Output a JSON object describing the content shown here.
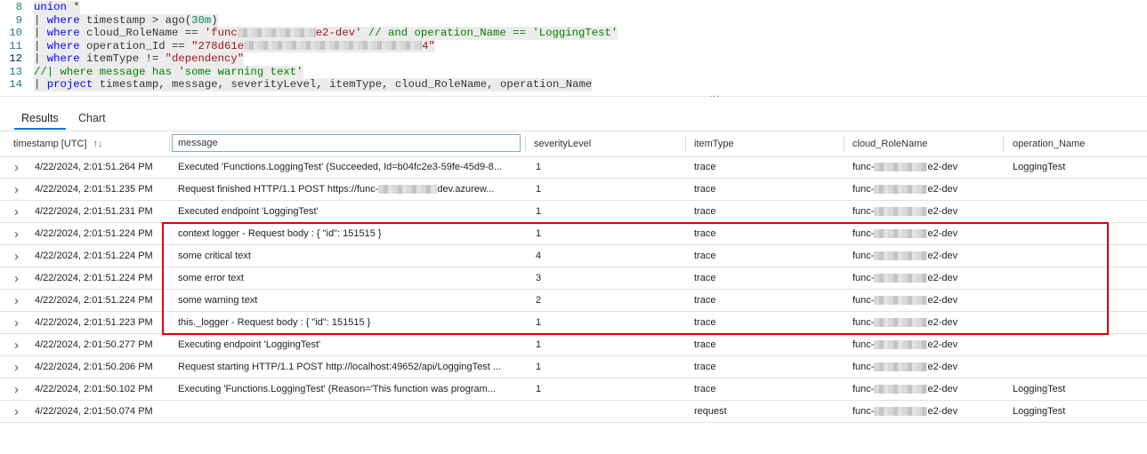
{
  "editor": {
    "current_line": 12,
    "lines": [
      {
        "n": "8",
        "tokens": [
          [
            "union",
            "kw"
          ],
          [
            " *",
            "op"
          ]
        ]
      },
      {
        "n": "9",
        "tokens": [
          [
            "| ",
            "op"
          ],
          [
            "where",
            "kw"
          ],
          [
            " timestamp > ago(",
            "pl"
          ],
          [
            "30m",
            "num"
          ],
          [
            ")",
            "pl"
          ]
        ]
      },
      {
        "n": "10",
        "tokens": [
          [
            "| ",
            "op"
          ],
          [
            "where",
            "kw"
          ],
          [
            " cloud_RoleName == ",
            "pl"
          ],
          [
            "'func",
            "str"
          ],
          [
            "",
            "blur"
          ],
          [
            "e2-dev'",
            "str"
          ],
          [
            " // and operation_Name == 'LoggingTest'",
            "cm"
          ]
        ]
      },
      {
        "n": "11",
        "tokens": [
          [
            "| ",
            "op"
          ],
          [
            "where",
            "kw"
          ],
          [
            " operation_Id == ",
            "pl"
          ],
          [
            "\"278d61e",
            "str"
          ],
          [
            "",
            "blurlong"
          ],
          [
            "4\"",
            "str"
          ]
        ]
      },
      {
        "n": "12",
        "tokens": [
          [
            "| ",
            "op"
          ],
          [
            "where",
            "kw"
          ],
          [
            " itemType != ",
            "pl"
          ],
          [
            "\"dependency\"",
            "str"
          ]
        ]
      },
      {
        "n": "13",
        "tokens": [
          [
            "//| where message has 'some warning text'",
            "cm"
          ]
        ]
      },
      {
        "n": "14",
        "tokens": [
          [
            "| ",
            "op"
          ],
          [
            "project",
            "kw"
          ],
          [
            " timestamp, message, severityLevel, itemType, cloud_RoleName, operation_Name",
            "pl"
          ]
        ]
      }
    ],
    "splitter_label": "..."
  },
  "tabs": [
    {
      "label": "Results",
      "active": true
    },
    {
      "label": "Chart",
      "active": false
    }
  ],
  "columns": {
    "timestamp": "timestamp [UTC]",
    "sort_icon": "↑↓",
    "message_filter": "message",
    "severityLevel": "severityLevel",
    "itemType": "itemType",
    "cloud_RoleName": "cloud_RoleName",
    "operation_Name": "operation_Name"
  },
  "highlight": {
    "color": "#e0000b",
    "first_row": 3,
    "last_row": 7
  },
  "rows": [
    {
      "timestamp": "4/22/2024, 2:01:51.264 PM",
      "message": "Executed 'Functions.LoggingTest' (Succeeded, Id=b04fc2e3-59fe-45d9-8...",
      "severityLevel": "1",
      "itemType": "trace",
      "role_prefix": "func-",
      "role_suffix": "e2-dev",
      "operation_Name": "LoggingTest"
    },
    {
      "timestamp": "4/22/2024, 2:01:51.235 PM",
      "message": "Request finished HTTP/1.1 POST https://func-",
      "message_suffix": "dev.azurew...",
      "severityLevel": "1",
      "itemType": "trace",
      "role_prefix": "func-",
      "role_suffix": "e2-dev",
      "operation_Name": ""
    },
    {
      "timestamp": "4/22/2024, 2:01:51.231 PM",
      "message": "Executed endpoint 'LoggingTest'",
      "severityLevel": "1",
      "itemType": "trace",
      "role_prefix": "func-",
      "role_suffix": "e2-dev",
      "operation_Name": ""
    },
    {
      "timestamp": "4/22/2024, 2:01:51.224 PM",
      "message": "context logger - Request body : { \"id\": 151515 }",
      "severityLevel": "1",
      "itemType": "trace",
      "role_prefix": "func-",
      "role_suffix": "e2-dev",
      "operation_Name": ""
    },
    {
      "timestamp": "4/22/2024, 2:01:51.224 PM",
      "message": "some critical text",
      "severityLevel": "4",
      "itemType": "trace",
      "role_prefix": "func-",
      "role_suffix": "e2-dev",
      "operation_Name": ""
    },
    {
      "timestamp": "4/22/2024, 2:01:51.224 PM",
      "message": "some error text",
      "severityLevel": "3",
      "itemType": "trace",
      "role_prefix": "func-",
      "role_suffix": "e2-dev",
      "operation_Name": ""
    },
    {
      "timestamp": "4/22/2024, 2:01:51.224 PM",
      "message": "some warning text",
      "severityLevel": "2",
      "itemType": "trace",
      "role_prefix": "func-",
      "role_suffix": "e2-dev",
      "operation_Name": ""
    },
    {
      "timestamp": "4/22/2024, 2:01:51.223 PM",
      "message": "this._logger - Request body : { \"id\": 151515 }",
      "severityLevel": "1",
      "itemType": "trace",
      "role_prefix": "func-",
      "role_suffix": "e2-dev",
      "operation_Name": ""
    },
    {
      "timestamp": "4/22/2024, 2:01:50.277 PM",
      "message": "Executing endpoint 'LoggingTest'",
      "severityLevel": "1",
      "itemType": "trace",
      "role_prefix": "func-",
      "role_suffix": "e2-dev",
      "operation_Name": ""
    },
    {
      "timestamp": "4/22/2024, 2:01:50.206 PM",
      "message": "Request starting HTTP/1.1 POST http://localhost:49652/api/LoggingTest ...",
      "severityLevel": "1",
      "itemType": "trace",
      "role_prefix": "func-",
      "role_suffix": "e2-dev",
      "operation_Name": ""
    },
    {
      "timestamp": "4/22/2024, 2:01:50.102 PM",
      "message": "Executing 'Functions.LoggingTest' (Reason='This function was program...",
      "severityLevel": "1",
      "itemType": "trace",
      "role_prefix": "func-",
      "role_suffix": "e2-dev",
      "operation_Name": "LoggingTest"
    },
    {
      "timestamp": "4/22/2024, 2:01:50.074 PM",
      "message": "",
      "severityLevel": "",
      "itemType": "request",
      "role_prefix": "func-",
      "role_suffix": "e2-dev",
      "operation_Name": "LoggingTest"
    }
  ]
}
